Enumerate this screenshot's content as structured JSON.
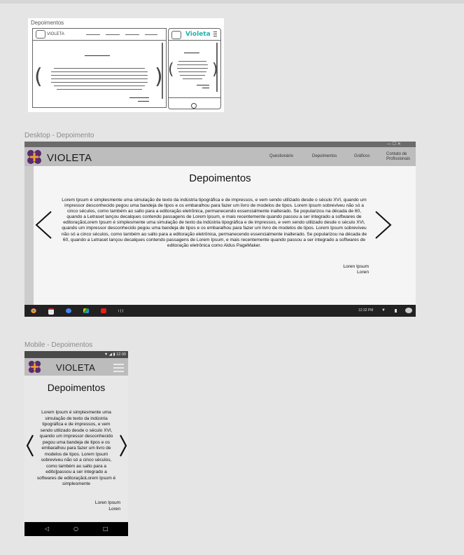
{
  "sketch": {
    "title": "Depoimentos",
    "desktop_brand": "VIOLETA",
    "mobile_brand": "Violeta"
  },
  "desktop": {
    "frame_label": "Desktop - Depoimento",
    "window_controls": "—  ☐  ✕",
    "brand": "VIOLETA",
    "nav": [
      "Questionário",
      "Depoimentos",
      "Gráficos",
      "Contato de Profissionais"
    ],
    "heading": "Depoimentos",
    "body": "Lorem Ipsum é simplesmente uma simulação de texto da indústria tipográfica e de impressos, e vem sendo utilizado desde o século XVI, quando um impressor desconhecido pegou uma bandeja de tipos e os embaralhou para fazer um livro de modelos de tipos. Lorem Ipsum sobreviveu não só a cinco séculos, como também ao salto para a editoração eletrônica, permanecendo essencialmente inalterado. Se popularizou na década de 60, quando a Letraset lançou decalques contendo passagens de Lorem Ipsum, e mais recentemente quando passou a ser integrado a softwares de editoraçãoLorem Ipsum é simplesmente uma simulação de texto da indústria tipográfica e de impressos, e vem sendo utilizado desde o século XVI, quando um impressor desconhecido pegou uma bandeja de tipos e os embaralhou para fazer um livro de modelos de tipos. Lorem Ipsum sobreviveu não só a cinco séculos, como também ao salto para a editoração eletrônica, permanecendo essencialmente inalterado. Se popularizou na década de 60, quando a Letraset lançou decalques contendo passagens de Lorem Ipsum, e mais recentemente quando passou a ser integrado a softwares de editoração eletrônica como Aldus PageMaker.",
    "author_name": "Loren Ipsum",
    "author_sub": "Loren",
    "taskbar_time": "12:32 PM",
    "taskbar_icons": [
      "chrome-icon",
      "gmail-icon",
      "docs-icon",
      "drive-icon",
      "youtube-icon",
      "apps-icon"
    ]
  },
  "mobile": {
    "frame_label": "Mobile - Depoimentos",
    "status_time": "12:30",
    "brand": "VIOLETA",
    "heading": "Depoimentos",
    "body": "Lorem Ipsum é simplesmente uma simulação de texto da indústria tipográfica e de impressos, e vem sendo utilizado desde o século XVI, quando um impressor desconhecido pegou uma bandeja de tipos e os embaralhou para fazer um livro de modelos de tipos. Lorem Ipsum sobreviveu não só a cinco séculos, como também ao salto para a edito]passou a ser integrado a softwares de editoraçãoLorem Ipsum é simplesmente",
    "author_name": "Loren Ipsum",
    "author_sub": "Loren"
  },
  "colors": {
    "accent_teal": "#1eb5a8",
    "logo_purple": "#5b2a6e",
    "logo_orange": "#f0a030",
    "nav_gray": "#bdbdbd",
    "taskbar": "#222222"
  }
}
